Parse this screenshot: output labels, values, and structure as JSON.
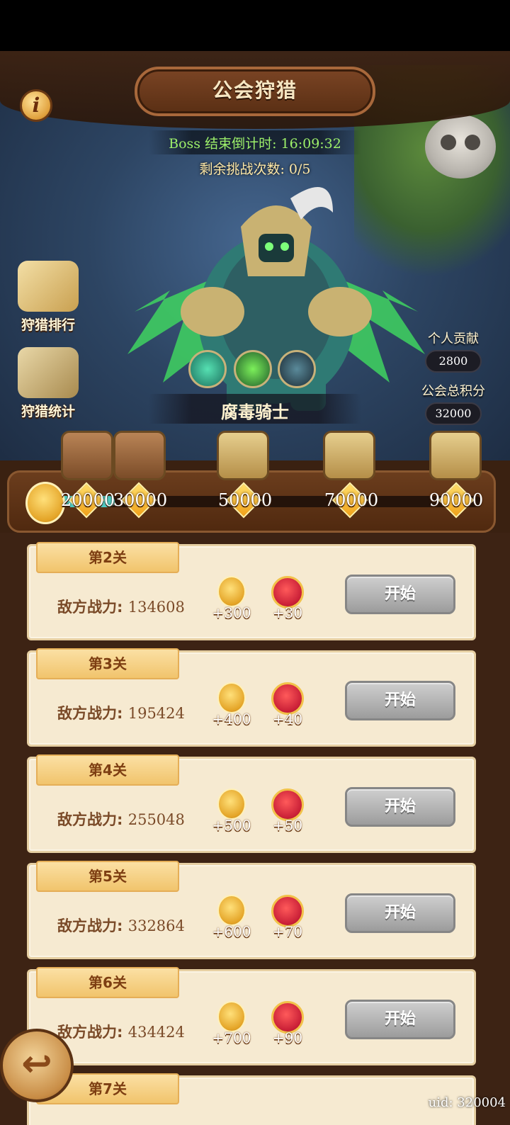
{
  "header": {
    "title": "公会狩猎",
    "countdown": "Boss 结束倒计时: 16:09:32",
    "attempts": "剩余挑战次数: 0/5",
    "info_icon": "i"
  },
  "side": {
    "rank_label": "狩猎排行",
    "stats_label": "狩猎统计"
  },
  "scores": {
    "personal_label": "个人贡献",
    "personal_value": "2800",
    "guild_label": "公会总积分",
    "guild_value": "32000"
  },
  "boss": {
    "name": "腐毒骑士",
    "skills": [
      "poison-wave-skill-icon",
      "thorn-skill-icon",
      "dark-spirit-skill-icon"
    ]
  },
  "rewards": {
    "progress_fraction": 0.15,
    "thresholds": [
      "20000",
      "30000",
      "50000",
      "70000",
      "90000"
    ]
  },
  "stages": [
    {
      "label": "第2关",
      "power_label": "敌方战力:",
      "power": "134608",
      "medal": "+300",
      "coin": "+30",
      "start": "开始"
    },
    {
      "label": "第3关",
      "power_label": "敌方战力:",
      "power": "195424",
      "medal": "+400",
      "coin": "+40",
      "start": "开始"
    },
    {
      "label": "第4关",
      "power_label": "敌方战力:",
      "power": "255048",
      "medal": "+500",
      "coin": "+50",
      "start": "开始"
    },
    {
      "label": "第5关",
      "power_label": "敌方战力:",
      "power": "332864",
      "medal": "+600",
      "coin": "+70",
      "start": "开始"
    },
    {
      "label": "第6关",
      "power_label": "敌方战力:",
      "power": "434424",
      "medal": "+700",
      "coin": "+90",
      "start": "开始"
    },
    {
      "label": "第7关"
    }
  ],
  "footer": {
    "uid": "uid: 320004"
  },
  "colors": {
    "panel_brown": "#3a2111",
    "card_bg": "#f6ead1",
    "countdown_green": "#9df06a"
  }
}
